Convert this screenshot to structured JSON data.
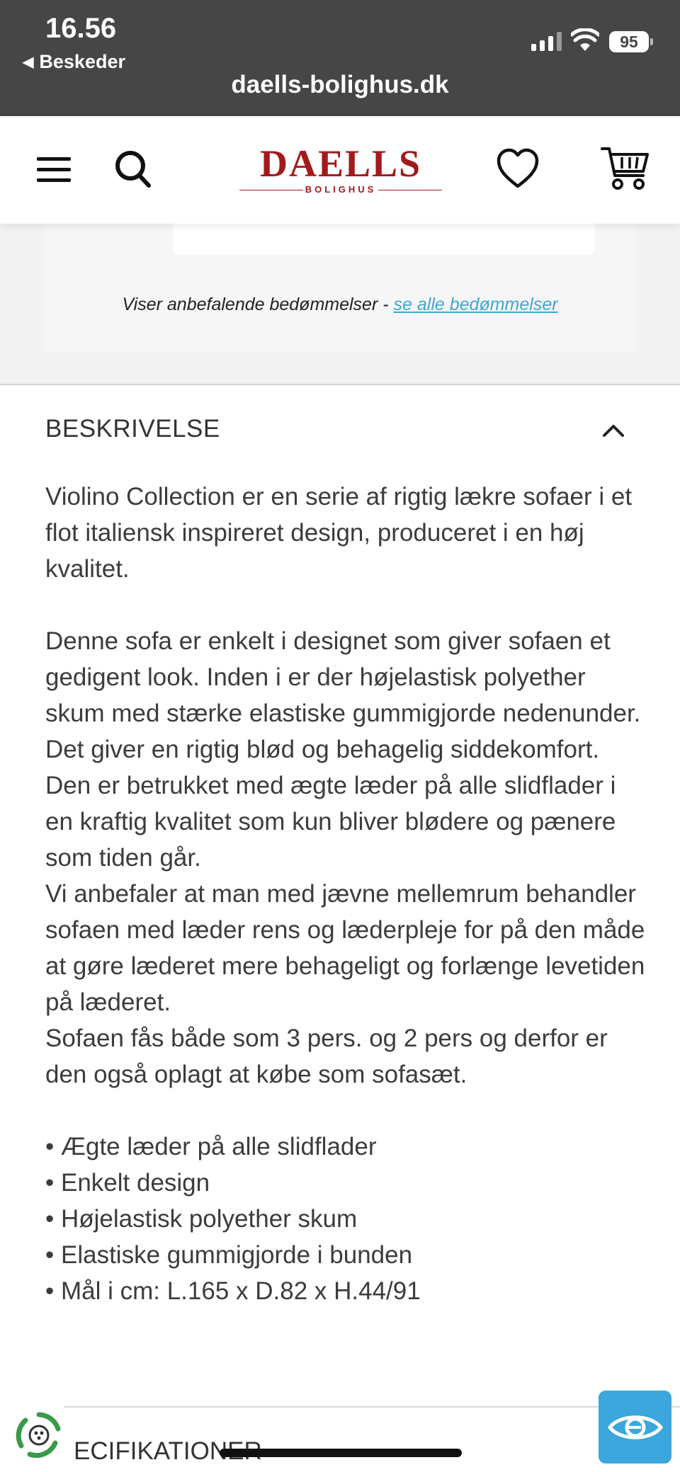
{
  "status_bar": {
    "time": "16.56",
    "back_label": "Beskeder",
    "url": "daells-bolighus.dk",
    "battery": "95"
  },
  "navbar": {
    "logo_main": "DAELLS",
    "logo_sub": "BOLIGHUS",
    "icons": [
      "menu-icon",
      "search-icon",
      "heart-icon",
      "cart-icon"
    ],
    "brand_color": "#a3191c"
  },
  "reviews": {
    "note_prefix": "Viser anbefalende bedømmelser - ",
    "see_all_link": "se alle bedømmelser",
    "link_color": "#3ea7d6"
  },
  "description": {
    "heading": "BESKRIVELSE",
    "intro": "Violino Collection er en serie af rigtig lækre sofaer i et flot italiensk inspireret design, produceret i en høj kvalitet.",
    "para1": "Denne sofa er enkelt i designet som giver sofaen et gedigent look. Inden i er der højelastisk polyether skum med stærke elastiske gummigjorde nedenunder. Det giver en rigtig blød og behagelig siddekomfort. Den er betrukket med ægte læder på alle slidflader i en kraftig kvalitet som kun bliver blødere og pænere som tiden går.",
    "para2": "Vi anbefaler at man med jævne mellemrum behandler sofaen med læder rens og læderpleje for på den måde at gøre læderet mere behageligt og forlænge levetiden på læderet.",
    "para3": "Sofaen fås både som 3 pers. og 2 pers og derfor er den også oplagt at købe som sofasæt.",
    "bullets": [
      "• Ægte læder på alle slidflader",
      "• Enkelt design",
      "• Højelastisk polyether skum",
      "• Elastiske gummigjorde i bunden",
      "• Mål i cm: L.165 x D.82 x H.44/91"
    ]
  },
  "specs": {
    "heading": "ECIFIKATIONER"
  },
  "accessibility_button": {
    "icon": "eye-icon",
    "color": "#3ba7dc"
  }
}
